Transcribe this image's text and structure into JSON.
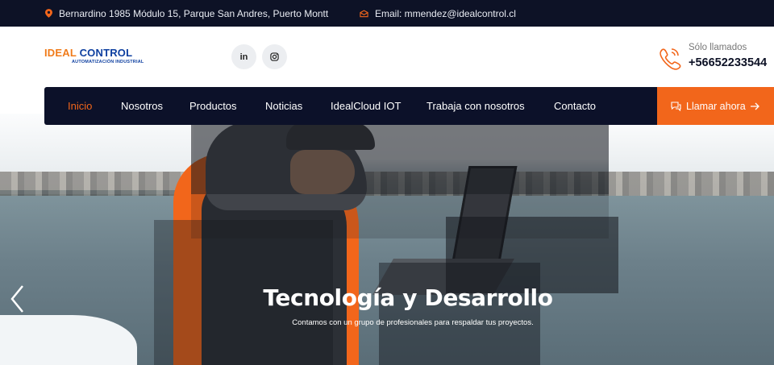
{
  "topbar": {
    "address": "Bernardino 1985 Módulo 15, Parque San Andres, Puerto Montt",
    "email": "Email: mmendez@idealcontrol.cl",
    "pin_icon": "map-pin-icon",
    "mail_icon": "envelope-icon"
  },
  "logo": {
    "ideal": "IDEAL",
    "control": "CONTROL",
    "tagline": "AUTOMATIZACIÓN INDUSTRIAL"
  },
  "social": {
    "linkedin": "in",
    "instagram_icon": "instagram-icon"
  },
  "contact": {
    "label": "Sólo llamados",
    "phone": "+56652233544",
    "icon": "phone-icon"
  },
  "nav": {
    "items": [
      {
        "label": "Inicio",
        "active": true
      },
      {
        "label": "Nosotros"
      },
      {
        "label": "Productos"
      },
      {
        "label": "Noticias"
      },
      {
        "label": "IdealCloud IOT"
      },
      {
        "label": "Trabaja con nosotros"
      },
      {
        "label": "Contacto"
      }
    ],
    "cta": "Llamar ahora"
  },
  "hero": {
    "title": "Tecnología y Desarrollo",
    "subtitle": "Contamos con un grupo de profesionales para respaldar tus proyectos."
  },
  "colors": {
    "dark": "#0c1129",
    "accent": "#f2661b",
    "brand_blue": "#0d3fa0"
  }
}
